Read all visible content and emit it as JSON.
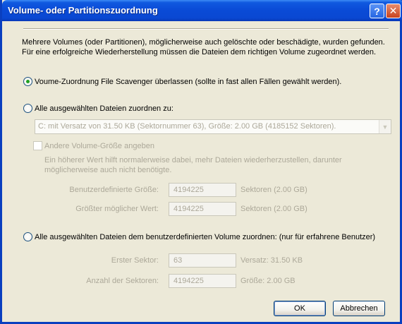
{
  "window": {
    "title": "Volume- oder Partitionszuordnung",
    "help_label": "?",
    "close_label": "✕"
  },
  "description": "Mehrere Volumes (oder Partitionen), möglicherweise auch gelöschte oder beschädigte, wurden gefunden. Für eine erfolgreiche Wiederherstellung müssen die Dateien dem richtigen Volume zugeordnet werden.",
  "option1": {
    "label": "Voume-Zuordnung File Scavenger überlassen (sollte in fast allen Fällen gewählt werden).",
    "selected": true
  },
  "option2": {
    "label": "Alle ausgewählten Dateien zuordnen zu:",
    "selected": false,
    "volume_select": "C: mit Versatz von 31.50 KB (Sektornummer 63), Größe: 2.00 GB (4185152 Sektoren).",
    "checkbox_label": "Andere Volume-Größe angeben",
    "checkbox_checked": false,
    "hint": "Ein höherer Wert hilft normalerweise dabei, mehr Dateien wiederherzustellen, darunter möglicherweise auch nicht benötigte.",
    "custom_size_label": "Benutzerdefinierte Größe:",
    "custom_size_value": "4194225",
    "custom_size_suffix": "Sektoren (2.00 GB)",
    "max_size_label": "Größter möglicher Wert:",
    "max_size_value": "4194225",
    "max_size_suffix": "Sektoren (2.00 GB)"
  },
  "option3": {
    "label": "Alle ausgewählten Dateien dem benutzerdefinierten Volume zuordnen: (nur für erfahrene Benutzer)",
    "selected": false,
    "first_sector_label": "Erster Sektor:",
    "first_sector_value": "63",
    "first_sector_suffix": "Versatz: 31.50 KB",
    "sector_count_label": "Anzahl der Sektoren:",
    "sector_count_value": "4194225",
    "sector_count_suffix": "Größe: 2.00 GB"
  },
  "buttons": {
    "ok": "OK",
    "cancel": "Abbrechen"
  },
  "colors": {
    "title_bar": "#0a4ad6",
    "dialog_bg": "#ece9d8",
    "radio_dot": "#21a121",
    "disabled_text": "#aca899"
  }
}
